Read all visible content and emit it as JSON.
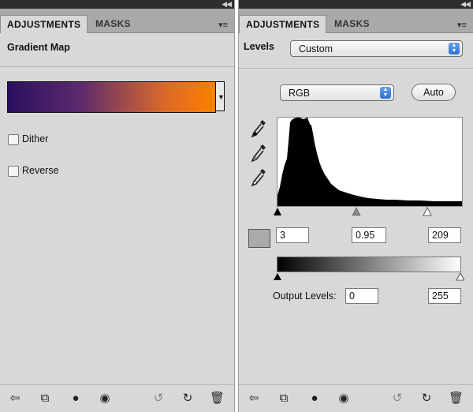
{
  "left_panel": {
    "tabs": [
      "ADJUSTMENTS",
      "MASKS"
    ],
    "title": "Gradient Map",
    "gradient": {
      "start_color": "#2a0f5e",
      "end_color": "#ff7f00"
    },
    "checkboxes": [
      {
        "label": "Dither",
        "checked": false
      },
      {
        "label": "Reverse",
        "checked": false
      }
    ],
    "bottom_icons": [
      "back-arrow-icon",
      "expand-view-icon",
      "clip-layer-icon",
      "visibility-eye-icon",
      "view-previous-icon",
      "reset-icon",
      "trash-icon"
    ]
  },
  "right_panel": {
    "tabs": [
      "ADJUSTMENTS",
      "MASKS"
    ],
    "title": "Levels",
    "preset_value": "Custom",
    "channel_value": "RGB",
    "auto_label": "Auto",
    "input_levels": {
      "black": "3",
      "gamma": "0.95",
      "white": "209"
    },
    "output_label": "Output Levels:",
    "output_levels": {
      "black": "0",
      "white": "255"
    },
    "eyedropper_icons": [
      "black-point-eyedropper-icon",
      "gray-point-eyedropper-icon",
      "white-point-eyedropper-icon"
    ],
    "bottom_icons": [
      "back-arrow-icon",
      "expand-view-icon",
      "clip-layer-icon",
      "visibility-eye-icon",
      "view-previous-icon",
      "reset-icon",
      "trash-icon"
    ]
  }
}
